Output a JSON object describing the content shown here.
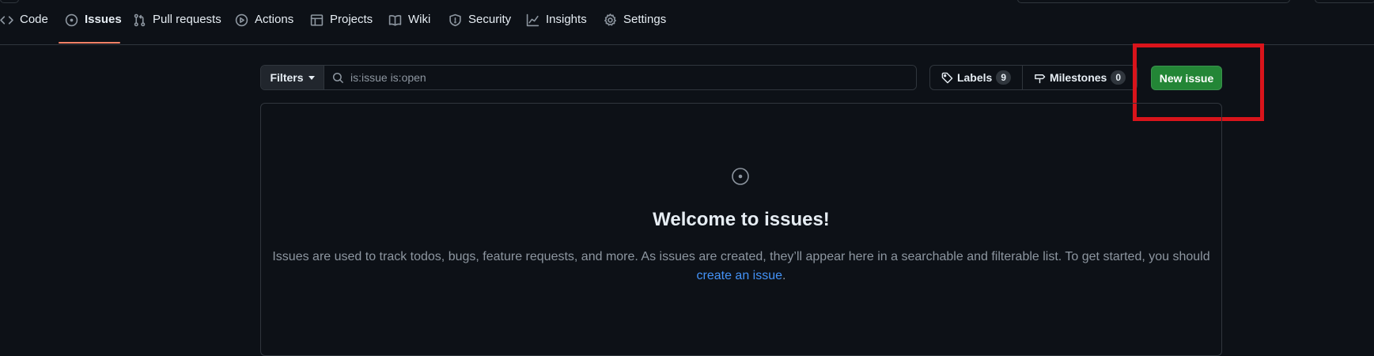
{
  "nav": {
    "tabs": [
      {
        "label": "Code",
        "icon": "code-icon"
      },
      {
        "label": "Issues",
        "icon": "issue-opened-icon",
        "active": true
      },
      {
        "label": "Pull requests",
        "icon": "git-pull-request-icon"
      },
      {
        "label": "Actions",
        "icon": "play-icon"
      },
      {
        "label": "Projects",
        "icon": "table-icon"
      },
      {
        "label": "Wiki",
        "icon": "book-icon"
      },
      {
        "label": "Security",
        "icon": "shield-icon"
      },
      {
        "label": "Insights",
        "icon": "graph-icon"
      },
      {
        "label": "Settings",
        "icon": "gear-icon"
      }
    ]
  },
  "toolbar": {
    "filters_label": "Filters",
    "search_value": "is:issue is:open",
    "labels_label": "Labels",
    "labels_count": "9",
    "milestones_label": "Milestones",
    "milestones_count": "0",
    "new_issue_label": "New issue"
  },
  "blankslate": {
    "title": "Welcome to issues!",
    "text_before_link": "Issues are used to track todos, bugs, feature requests, and more. As issues are created, they’ll appear here in a searchable and filterable list. To get started, you should ",
    "link_text": "create an issue",
    "text_after_link": "."
  },
  "colors": {
    "background": "#0d1117",
    "border": "#30363d",
    "primary_button": "#238636",
    "active_tab_underline": "#f78166",
    "link": "#4493f8",
    "highlight_annotation": "#d9141b"
  }
}
